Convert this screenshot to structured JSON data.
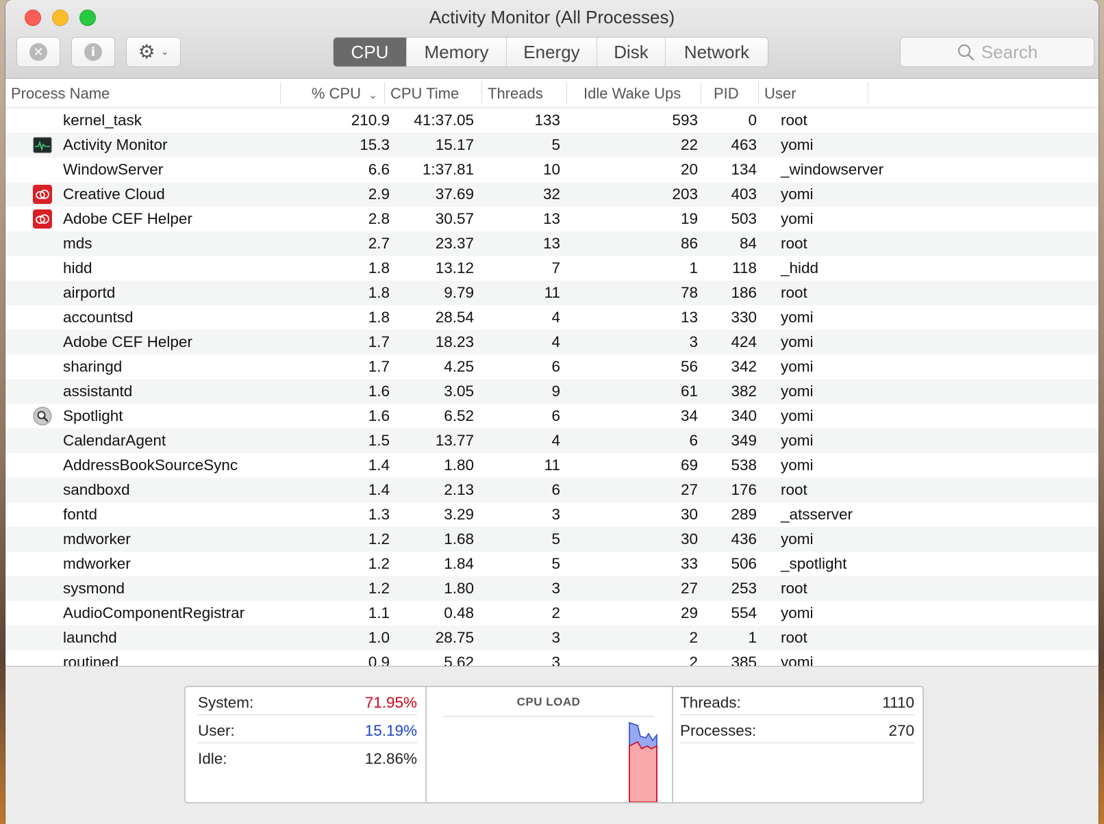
{
  "window": {
    "title": "Activity Monitor (All Processes)"
  },
  "toolbar": {
    "stop_icon": "x-circle-icon",
    "info_icon": "info-circle-icon",
    "gear_icon": "gear-icon",
    "tabs": [
      {
        "label": "CPU",
        "active": true
      },
      {
        "label": "Memory",
        "active": false
      },
      {
        "label": "Energy",
        "active": false
      },
      {
        "label": "Disk",
        "active": false
      },
      {
        "label": "Network",
        "active": false
      }
    ],
    "search_placeholder": "Search"
  },
  "table": {
    "columns": {
      "name": "Process Name",
      "cpu": "% CPU",
      "cpu_time": "CPU Time",
      "threads": "Threads",
      "idle_wake_ups": "Idle Wake Ups",
      "pid": "PID",
      "user": "User"
    },
    "sort_column": "cpu",
    "sort_direction": "descending",
    "rows": [
      {
        "name": "kernel_task",
        "cpu": "210.9",
        "time": "41:37.05",
        "threads": "133",
        "idle": "593",
        "pid": "0",
        "user": "root",
        "icon": ""
      },
      {
        "name": "Activity Monitor",
        "cpu": "15.3",
        "time": "15.17",
        "threads": "5",
        "idle": "22",
        "pid": "463",
        "user": "yomi",
        "icon": "activity-monitor-icon"
      },
      {
        "name": "WindowServer",
        "cpu": "6.6",
        "time": "1:37.81",
        "threads": "10",
        "idle": "20",
        "pid": "134",
        "user": "_windowserver",
        "icon": ""
      },
      {
        "name": "Creative Cloud",
        "cpu": "2.9",
        "time": "37.69",
        "threads": "32",
        "idle": "203",
        "pid": "403",
        "user": "yomi",
        "icon": "creative-cloud-icon"
      },
      {
        "name": "Adobe CEF Helper",
        "cpu": "2.8",
        "time": "30.57",
        "threads": "13",
        "idle": "19",
        "pid": "503",
        "user": "yomi",
        "icon": "creative-cloud-icon"
      },
      {
        "name": "mds",
        "cpu": "2.7",
        "time": "23.37",
        "threads": "13",
        "idle": "86",
        "pid": "84",
        "user": "root",
        "icon": ""
      },
      {
        "name": "hidd",
        "cpu": "1.8",
        "time": "13.12",
        "threads": "7",
        "idle": "1",
        "pid": "118",
        "user": "_hidd",
        "icon": ""
      },
      {
        "name": "airportd",
        "cpu": "1.8",
        "time": "9.79",
        "threads": "11",
        "idle": "78",
        "pid": "186",
        "user": "root",
        "icon": ""
      },
      {
        "name": "accountsd",
        "cpu": "1.8",
        "time": "28.54",
        "threads": "4",
        "idle": "13",
        "pid": "330",
        "user": "yomi",
        "icon": ""
      },
      {
        "name": "Adobe CEF Helper",
        "cpu": "1.7",
        "time": "18.23",
        "threads": "4",
        "idle": "3",
        "pid": "424",
        "user": "yomi",
        "icon": ""
      },
      {
        "name": "sharingd",
        "cpu": "1.7",
        "time": "4.25",
        "threads": "6",
        "idle": "56",
        "pid": "342",
        "user": "yomi",
        "icon": ""
      },
      {
        "name": "assistantd",
        "cpu": "1.6",
        "time": "3.05",
        "threads": "9",
        "idle": "61",
        "pid": "382",
        "user": "yomi",
        "icon": ""
      },
      {
        "name": "Spotlight",
        "cpu": "1.6",
        "time": "6.52",
        "threads": "6",
        "idle": "34",
        "pid": "340",
        "user": "yomi",
        "icon": "spotlight-icon"
      },
      {
        "name": "CalendarAgent",
        "cpu": "1.5",
        "time": "13.77",
        "threads": "4",
        "idle": "6",
        "pid": "349",
        "user": "yomi",
        "icon": ""
      },
      {
        "name": "AddressBookSourceSync",
        "cpu": "1.4",
        "time": "1.80",
        "threads": "11",
        "idle": "69",
        "pid": "538",
        "user": "yomi",
        "icon": ""
      },
      {
        "name": "sandboxd",
        "cpu": "1.4",
        "time": "2.13",
        "threads": "6",
        "idle": "27",
        "pid": "176",
        "user": "root",
        "icon": ""
      },
      {
        "name": "fontd",
        "cpu": "1.3",
        "time": "3.29",
        "threads": "3",
        "idle": "30",
        "pid": "289",
        "user": "_atsserver",
        "icon": ""
      },
      {
        "name": "mdworker",
        "cpu": "1.2",
        "time": "1.68",
        "threads": "5",
        "idle": "30",
        "pid": "436",
        "user": "yomi",
        "icon": ""
      },
      {
        "name": "mdworker",
        "cpu": "1.2",
        "time": "1.84",
        "threads": "5",
        "idle": "33",
        "pid": "506",
        "user": "_spotlight",
        "icon": ""
      },
      {
        "name": "sysmond",
        "cpu": "1.2",
        "time": "1.80",
        "threads": "3",
        "idle": "27",
        "pid": "253",
        "user": "root",
        "icon": ""
      },
      {
        "name": "AudioComponentRegistrar",
        "cpu": "1.1",
        "time": "0.48",
        "threads": "2",
        "idle": "29",
        "pid": "554",
        "user": "yomi",
        "icon": ""
      },
      {
        "name": "launchd",
        "cpu": "1.0",
        "time": "28.75",
        "threads": "3",
        "idle": "2",
        "pid": "1",
        "user": "root",
        "icon": ""
      },
      {
        "name": "routined",
        "cpu": "0.9",
        "time": "5.62",
        "threads": "3",
        "idle": "2",
        "pid": "385",
        "user": "yomi",
        "icon": ""
      }
    ]
  },
  "summary": {
    "system_label": "System:",
    "system_value": "71.95%",
    "user_label": "User:",
    "user_value": "15.19%",
    "idle_label": "Idle:",
    "idle_value": "12.86%",
    "cpu_load_title": "CPU LOAD",
    "threads_label": "Threads:",
    "threads_value": "1110",
    "processes_label": "Processes:",
    "processes_value": "270",
    "colors": {
      "system": "#d0021b",
      "user": "#1a3fcf"
    }
  }
}
